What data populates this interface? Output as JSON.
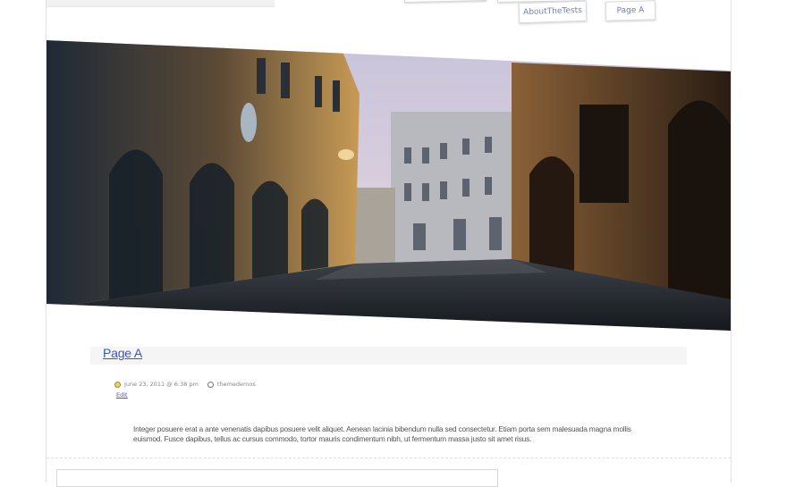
{
  "nav": {
    "tabs": [
      {
        "label": ""
      },
      {
        "label": ""
      },
      {
        "label": "AboutTheTests"
      },
      {
        "label": "Page A"
      }
    ]
  },
  "post": {
    "title": "Page A",
    "date": "June 23, 2011 @ 6:38 pm",
    "author": "themedemos",
    "edit_label": "Edit",
    "body": "Integer posuere erat a ante venenatis dapibus posuere velit aliquet. Aenean lacinia bibendum nulla sed consectetur. Etiam porta sem malesuada magna mollis euismod. Fusce dapibus, tellus ac cursus commodo, tortor mauris condimentum nibh, ut fermentum massa justo sit amet risus."
  },
  "colors": {
    "link": "#3b55c6",
    "meta_text": "#888888",
    "body_text": "#555555",
    "title_bar_bg": "#f5f5f5"
  },
  "icons": {
    "date": "clock-icon",
    "author": "user-icon"
  }
}
